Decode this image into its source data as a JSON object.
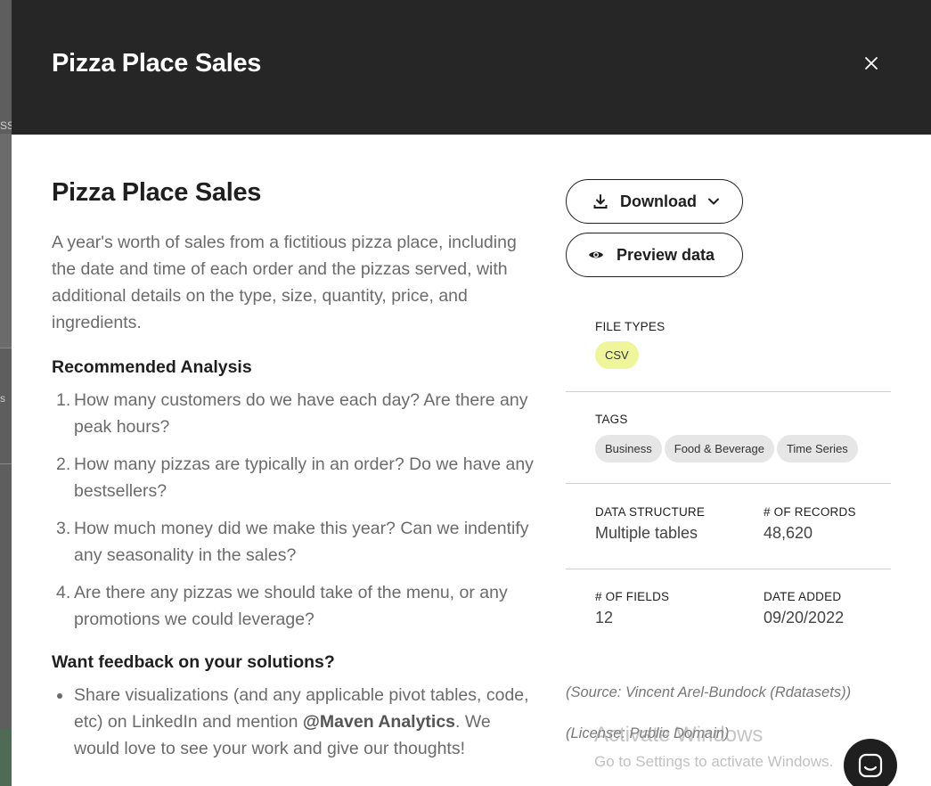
{
  "modal": {
    "title": "Pizza Place Sales",
    "close_icon": "close-icon"
  },
  "dataset": {
    "title": "Pizza Place Sales",
    "description": "A year's worth of sales from a fictitious pizza place, including the date and time of each order and the pizzas served, with additional details on the type, size, quantity, price, and ingredients.",
    "analysis_heading": "Recommended Analysis",
    "analysis": [
      {
        "num": "1.",
        "text": "How many customers do we have each day? Are there any peak hours?"
      },
      {
        "num": "2.",
        "text": "How many pizzas are typically in an order? Do we have any bestsellers?"
      },
      {
        "num": "3.",
        "text": "How much money did we make this year? Can we indentify any seasonality in the sales?"
      },
      {
        "num": "4.",
        "text": "Are there any pizzas we should take of the menu, or any promotions we could leverage?"
      }
    ],
    "feedback_heading": "Want feedback on your solutions?",
    "feedback_text_before": "Share visualizations (and any applicable pivot tables, code, etc) on LinkedIn and mention ",
    "feedback_mention": "@Maven Analytics",
    "feedback_text_after": ". We would love to see your work and give our thoughts!"
  },
  "actions": {
    "download_label": "Download",
    "download_icon": "download-icon",
    "download_chevron_icon": "chevron-down-icon",
    "preview_label": "Preview data",
    "preview_icon": "eye-icon"
  },
  "file_types": {
    "label": "FILE TYPES",
    "items": [
      "CSV"
    ]
  },
  "tags": {
    "label": "TAGS",
    "items": [
      "Business",
      "Food & Beverage",
      "Time Series"
    ]
  },
  "structure": {
    "data_structure_label": "DATA STRUCTURE",
    "data_structure_value": "Multiple tables",
    "records_label": "# OF RECORDS",
    "records_value": "48,620",
    "fields_label": "# OF FIELDS",
    "fields_value": "12",
    "date_added_label": "DATE ADDED",
    "date_added_value": "09/20/2022"
  },
  "source": {
    "source_text": "(Source: Vincent Arel-Bundock (Rdatasets))",
    "license_text": "(License: Public Domain)"
  },
  "watermark": {
    "line1": "Activate Windows",
    "line2": "Go to Settings to activate Windows."
  },
  "background": {
    "fragment1": "SS",
    "fragment2": "s"
  },
  "chat": {
    "icon": "chat-icon"
  },
  "colors": {
    "header_bg": "#262626",
    "csv_chip": "#eef59a",
    "tag_chip": "#e6e6e6",
    "text_body": "#6b6b6b"
  }
}
